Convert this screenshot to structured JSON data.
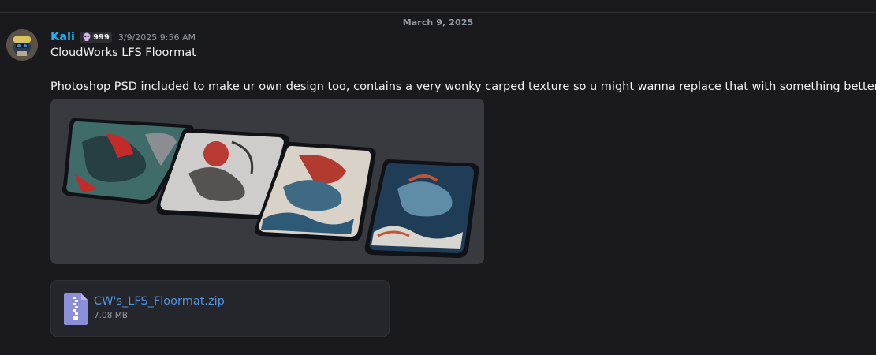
{
  "date_divider": "March 9, 2025",
  "message": {
    "author": "Kali",
    "badge_count": "999",
    "badge_icon": "skull-icon",
    "timestamp": "3/9/2025 9:56 AM",
    "title_line": "CloudWorks LFS Floormat",
    "body_line": "Photoshop PSD included to make ur own design too, contains a very wonky carped texture so u might wanna replace that with something better"
  },
  "attachment": {
    "file_name": "CW's_LFS_Floormat.zip",
    "file_size": "7.08 MB",
    "icon": "zip-file-icon"
  },
  "colors": {
    "author": "#1fb0ef",
    "link": "#4e94e4",
    "background": "#1a1a1e"
  }
}
